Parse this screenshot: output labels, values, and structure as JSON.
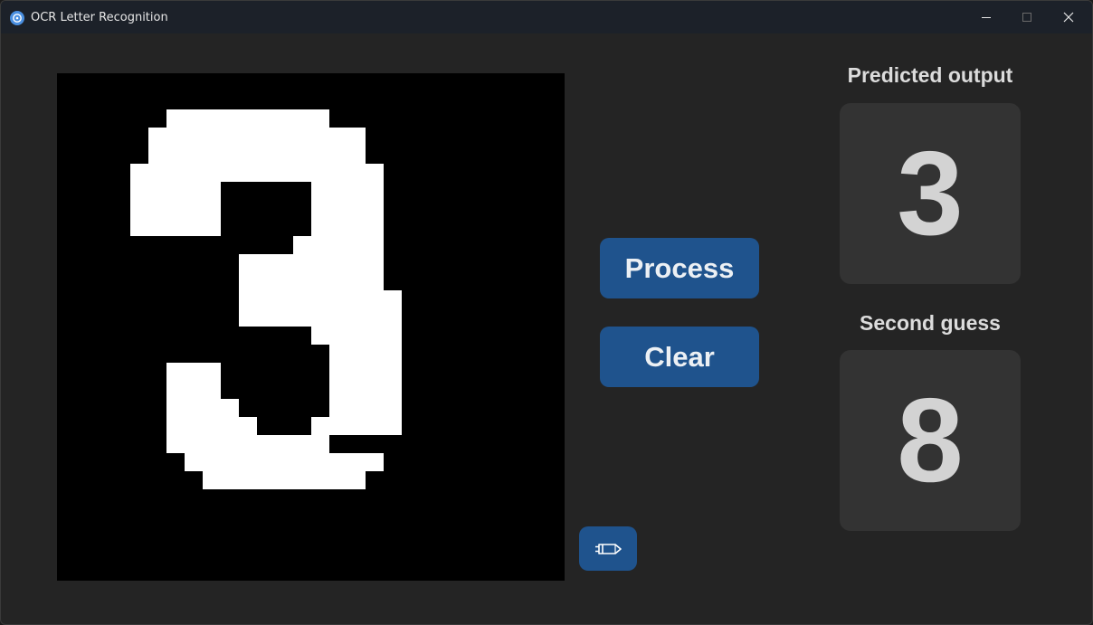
{
  "window": {
    "title": "OCR Letter Recognition",
    "icon": "app-icon",
    "controls": [
      "minimize-icon",
      "maximize-icon",
      "close-icon"
    ]
  },
  "canvas": {
    "background": "#000000",
    "stroke_color": "#ffffff",
    "drawn_glyph": "3"
  },
  "buttons": {
    "process_label": "Process",
    "clear_label": "Clear",
    "pencil_icon": "pencil-icon"
  },
  "results": {
    "predicted_label": "Predicted output",
    "predicted_value": "3",
    "second_label": "Second guess",
    "second_value": "8"
  },
  "colors": {
    "accent": "#1f538d",
    "window_bg": "#242424",
    "titlebar_bg": "#1c2129",
    "result_box_bg": "#333333"
  }
}
